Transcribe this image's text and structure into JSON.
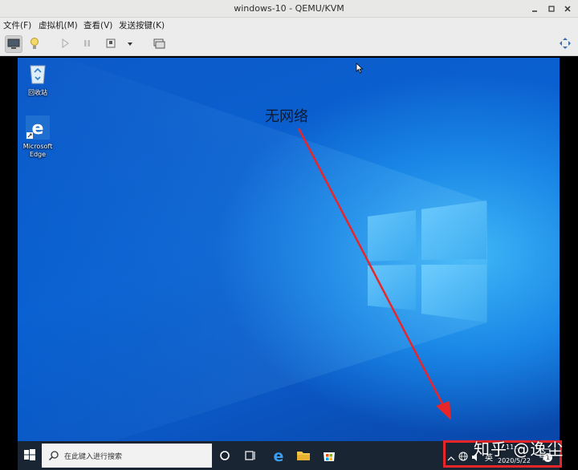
{
  "window": {
    "title": "windows-10 - QEMU/KVM"
  },
  "menu": {
    "items": [
      "文件(F)",
      "虚拟机(M)",
      "查看(V)",
      "发送按键(K)"
    ]
  },
  "desktop": {
    "icons": [
      {
        "label": "回收站",
        "icon": "recycle-bin-icon"
      },
      {
        "label": "Microsoft Edge",
        "icon": "edge-icon"
      }
    ],
    "annotation": "无网络"
  },
  "taskbar": {
    "search_placeholder": "在此键入进行搜索",
    "ime": "英",
    "time": "11:...",
    "date": "2020/5/22",
    "notification_count": "1"
  },
  "watermark": "知乎 @逸尘",
  "colors": {
    "annotation_red": "#e8262a",
    "taskbar": "#1a2533"
  }
}
